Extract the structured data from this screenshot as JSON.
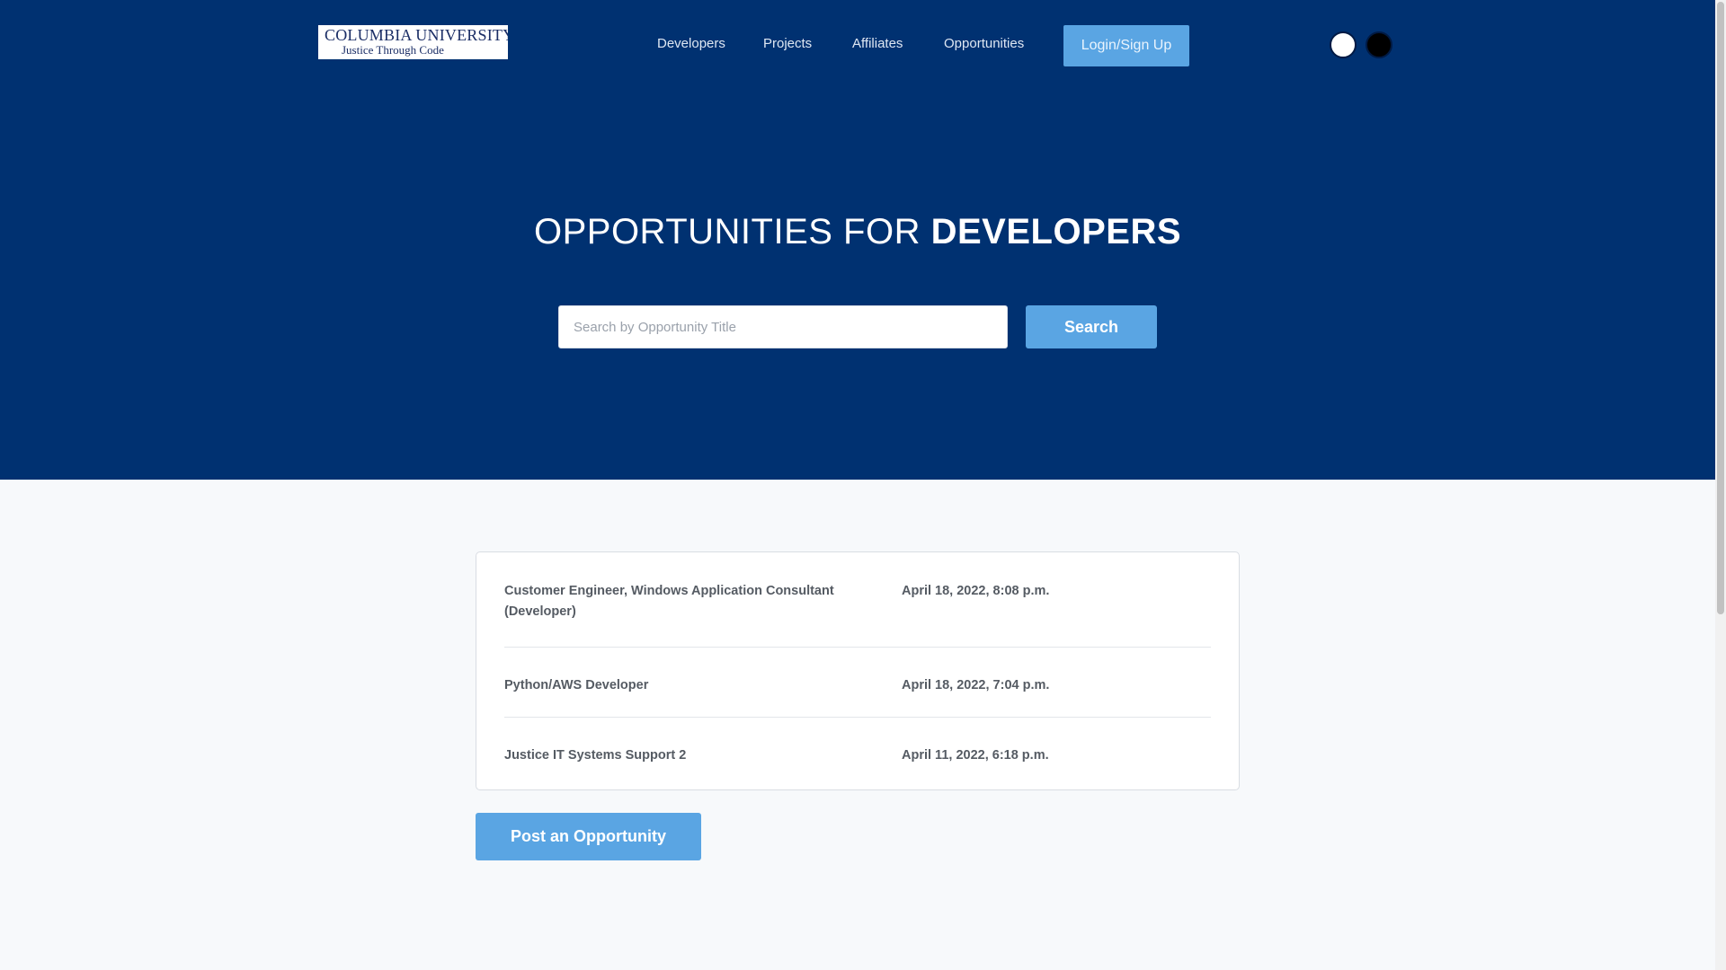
{
  "header": {
    "logo_name": "COLUMBIA UNIVERSITY",
    "logo_tagline": "Justice Through Code",
    "nav": [
      {
        "label": "Developers"
      },
      {
        "label": "Projects"
      },
      {
        "label": "Affiliates"
      },
      {
        "label": "Opportunities"
      }
    ],
    "login_label": "Login/Sign Up",
    "theme_options": [
      "light",
      "dark"
    ]
  },
  "hero": {
    "title_prefix": "OPPORTUNITIES FOR ",
    "title_emphasis": "DEVELOPERS",
    "search": {
      "placeholder": "Search by Opportunity Title",
      "value": "",
      "button_label": "Search"
    }
  },
  "opportunities": [
    {
      "title": "Customer Engineer, Windows Application Consultant (Developer)",
      "date": "April 18, 2022, 8:08 p.m."
    },
    {
      "title": "Python/AWS Developer",
      "date": "April 18, 2022, 7:04 p.m."
    },
    {
      "title": "Justice IT Systems Support 2",
      "date": "April 11, 2022, 6:18 p.m."
    }
  ],
  "post_label": "Post an Opportunity",
  "colors": {
    "hero_bg": "#003171",
    "accent": "#5aa5e3",
    "page_bg": "#f7f9fb"
  }
}
